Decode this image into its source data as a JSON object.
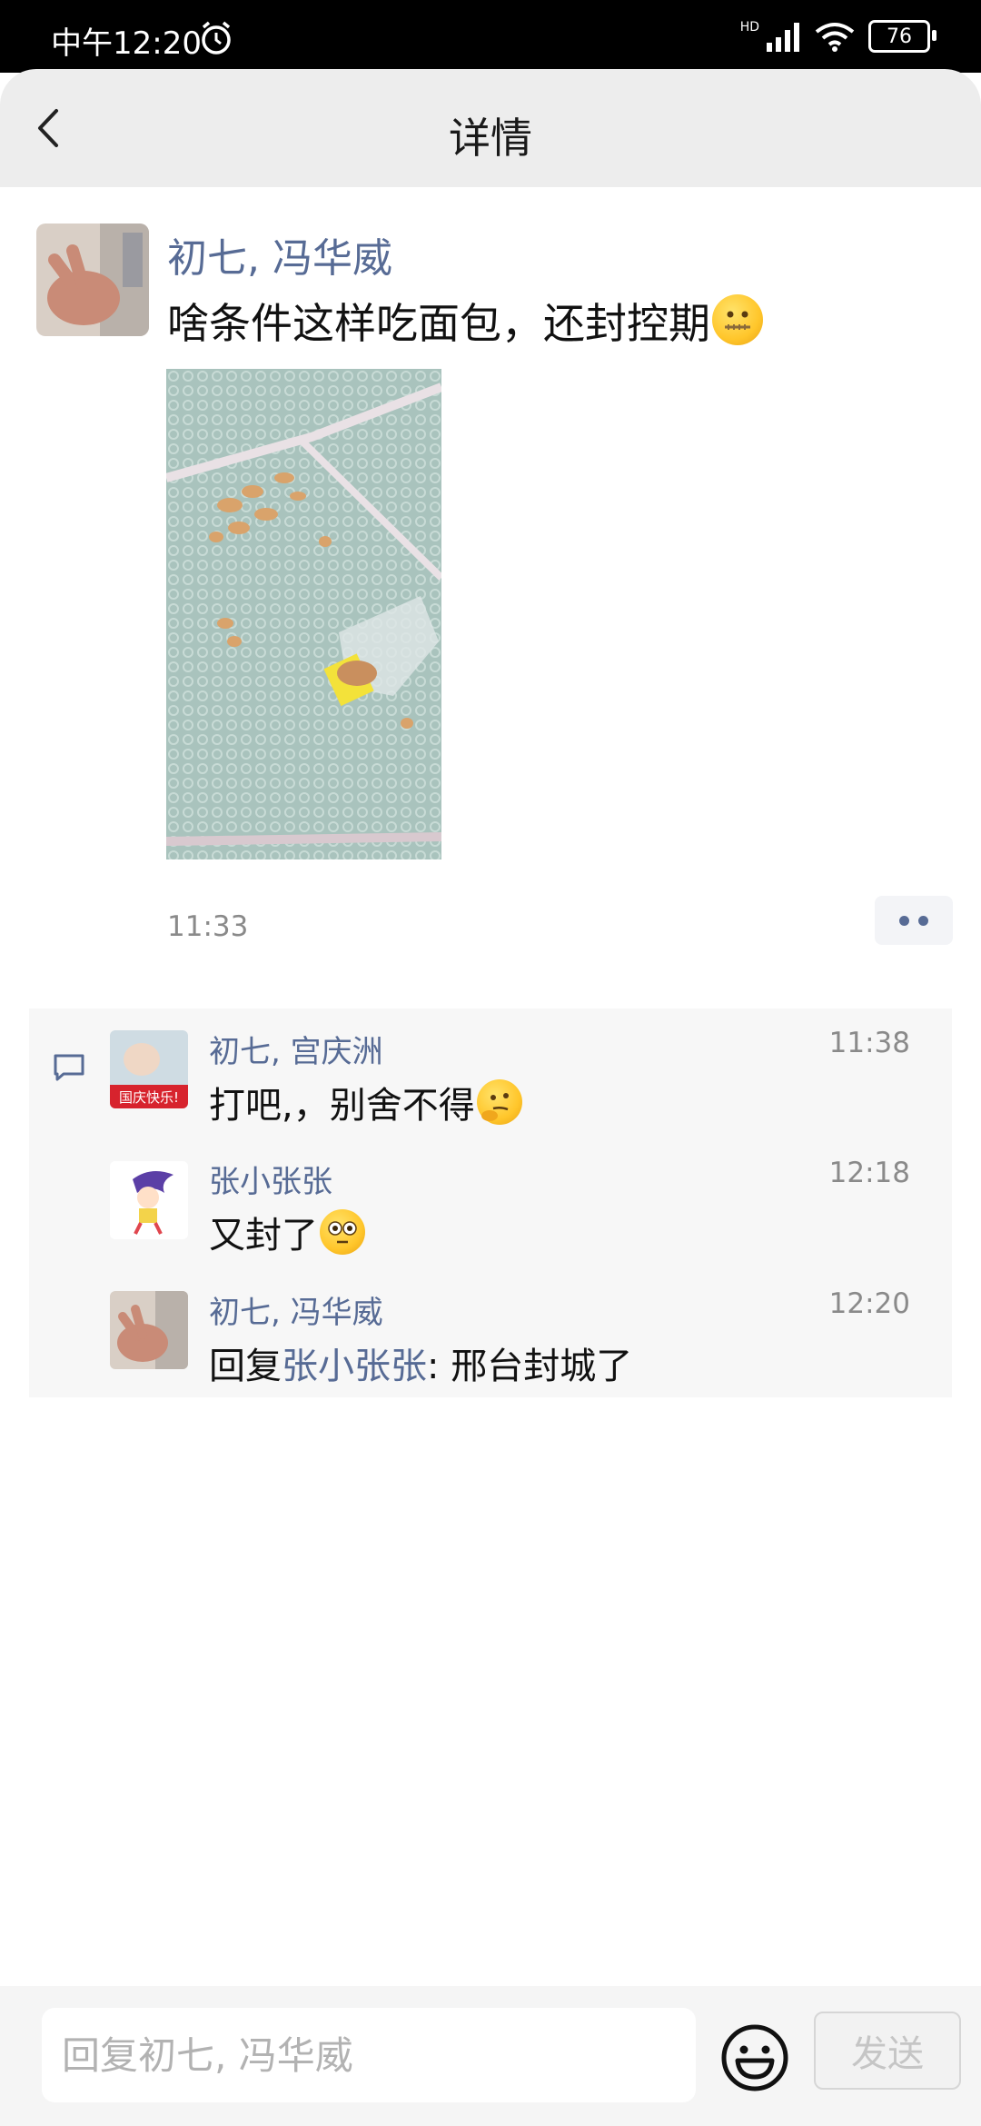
{
  "status_bar": {
    "time": "中午12:20",
    "network": "HD",
    "battery": "76"
  },
  "header": {
    "title": "详情"
  },
  "post": {
    "author": "初七, 冯华威",
    "text": "啥条件这样吃面包，还封控期",
    "time": "11:33"
  },
  "comments": [
    {
      "name": "初七, 宫庆洲",
      "time": "11:38",
      "text": "打吧,，别舍不得"
    },
    {
      "name": "张小张张",
      "time": "12:18",
      "text": "又封了"
    },
    {
      "name": "初七, 冯华威",
      "time": "12:20",
      "reply_prefix": "回复",
      "reply_target": "张小张张",
      "text": ": 邢台封城了"
    }
  ],
  "avatar_badge": "国庆快乐!",
  "input": {
    "placeholder": "回复初七, 冯华威"
  },
  "send_label": "发送",
  "colors": {
    "link": "#576b95",
    "header_bg": "#ededed",
    "comment_bg": "#f7f7f7"
  }
}
